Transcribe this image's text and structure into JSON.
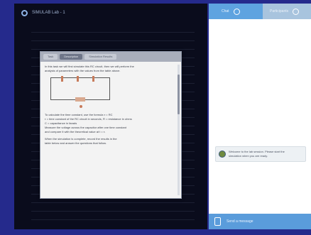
{
  "window": {
    "title": "SIMULAB Lab - 1"
  },
  "dialog": {
    "tabs": [
      {
        "label": "Task"
      },
      {
        "label": "Description"
      },
      {
        "label": "Simulation Results"
      }
    ],
    "lines": [
      "In this task we will first simulate this RC circuit, then we will perform the",
      "analysis of parameters with the values from the table above.",
      "To calculate the time constant, use the formula τ = RC",
      "τ = time constant of the RC circuit in seconds, R = resistance in ohms",
      "C = capacitance in farads",
      "Measure the voltage across the capacitor after one time constant",
      "and compare it with the theoretical value at t = τ.",
      "When the simulation is complete, record the results in the",
      "table below and answer the questions that follow."
    ]
  },
  "chat": {
    "tabs": [
      {
        "label": "Chat"
      },
      {
        "label": "Participants"
      }
    ],
    "message": {
      "line1": "Welcome to the lab session. Please start the",
      "line2": "simulation when you are ready."
    },
    "input_hint": "Send a message"
  },
  "colors": {
    "background": "#252a8c",
    "editor": "#0a0c1c",
    "chat_accent": "#5a9cdb"
  }
}
